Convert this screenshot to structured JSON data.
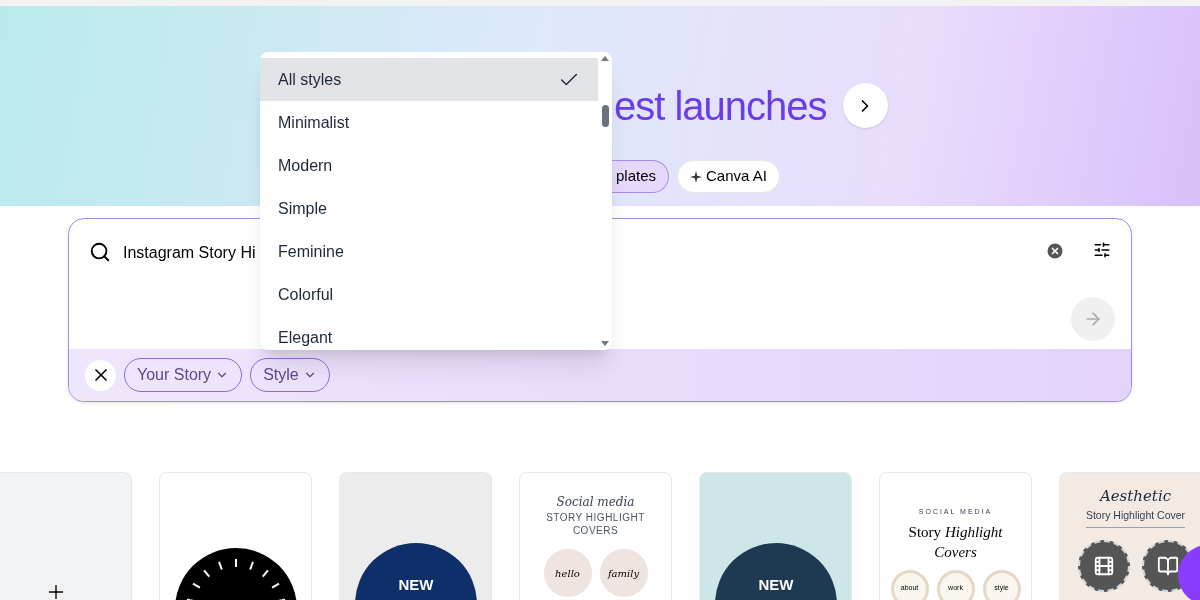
{
  "heading": {
    "text": "est launches"
  },
  "chips": [
    {
      "label": "plates",
      "selected": true
    },
    {
      "label": "Canva AI",
      "selected": false
    }
  ],
  "search": {
    "value": "Instagram Story Hi"
  },
  "filters": [
    {
      "label": "Your Story"
    },
    {
      "label": "Style"
    }
  ],
  "dropdown": {
    "items": [
      {
        "label": "All styles",
        "selected": true
      },
      {
        "label": "Minimalist",
        "selected": false
      },
      {
        "label": "Modern",
        "selected": false
      },
      {
        "label": "Simple",
        "selected": false
      },
      {
        "label": "Feminine",
        "selected": false
      },
      {
        "label": "Colorful",
        "selected": false
      },
      {
        "label": "Elegant",
        "selected": false
      }
    ]
  },
  "templates": [
    {
      "kind": "blank"
    },
    {
      "kind": "dial"
    },
    {
      "kind": "paper",
      "text": "NEW"
    },
    {
      "kind": "script",
      "title": "Social media",
      "lines": [
        "STORY HIGHLIGHT",
        "COVERS"
      ],
      "circles": [
        "hello",
        "family"
      ]
    },
    {
      "kind": "watercolor",
      "text": "NEW"
    },
    {
      "kind": "serif",
      "eyebrow": "SOCIAL MEDIA",
      "title": "Story *Highlight*",
      "subtitle": "Covers",
      "circles": [
        "about",
        "work",
        "style"
      ]
    },
    {
      "kind": "aesthetic",
      "title": "Aesthetic",
      "subtitle": "Story Highlight Cover"
    }
  ]
}
